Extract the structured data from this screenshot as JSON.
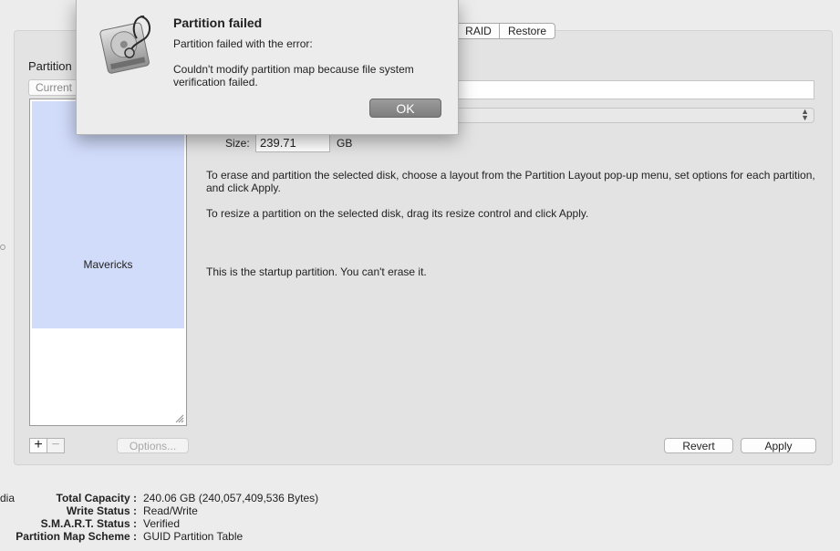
{
  "tabs": {
    "raid": "RAID",
    "restore": "Restore"
  },
  "partition": {
    "section_label": "Partition",
    "layout_popup": "Current",
    "partitions": [
      {
        "name": "Mavericks"
      }
    ]
  },
  "size": {
    "label": "Size:",
    "value": "239.71",
    "unit": "GB"
  },
  "instructions": {
    "erase": "To erase and partition the selected disk, choose a layout from the Partition Layout pop-up menu, set options for each partition, and click Apply.",
    "resize": "To resize a partition on the selected disk, drag its resize control and click Apply.",
    "startup": "This is the startup partition. You can't erase it."
  },
  "buttons": {
    "add": "+",
    "remove": "−",
    "options": "Options...",
    "revert": "Revert",
    "apply": "Apply"
  },
  "disk_info": {
    "left_fragment": "dia",
    "rows": [
      {
        "label": "Total Capacity :",
        "value": "240.06 GB (240,057,409,536 Bytes)"
      },
      {
        "label": "Write Status :",
        "value": "Read/Write"
      },
      {
        "label": "S.M.A.R.T. Status :",
        "value": "Verified"
      },
      {
        "label": "Partition Map Scheme :",
        "value": "GUID Partition Table"
      }
    ]
  },
  "alert": {
    "title": "Partition failed",
    "message1": "Partition failed with the error:",
    "message2": "Couldn't modify partition map because file system verification failed.",
    "ok": "OK",
    "icon": "disk-utility-icon"
  },
  "colors": {
    "partition_fill": "#d1dcfb",
    "ok_button": "#8c8c8c"
  }
}
